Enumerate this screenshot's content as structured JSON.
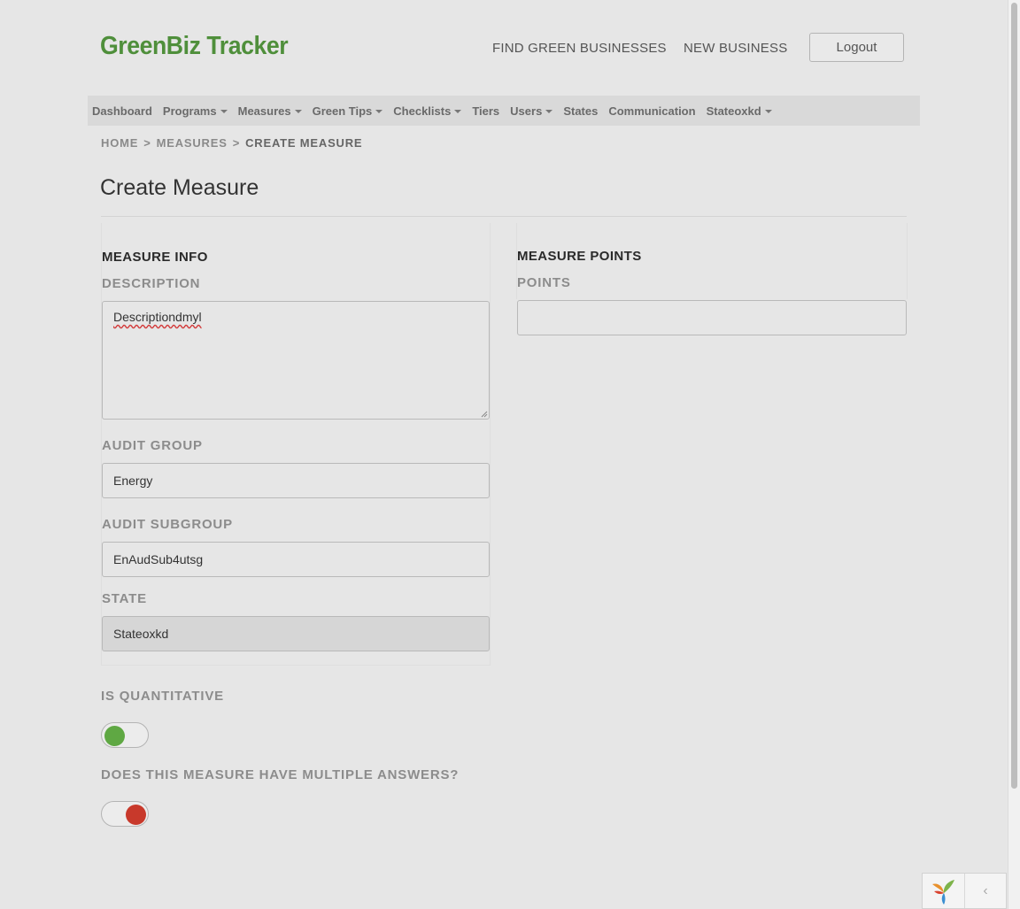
{
  "header": {
    "brand": "GreenBiz Tracker",
    "nav": [
      "FIND GREEN BUSINESSES",
      "NEW BUSINESS"
    ],
    "logout_label": "Logout"
  },
  "menu": {
    "items": [
      {
        "label": "Dashboard",
        "dropdown": false
      },
      {
        "label": "Programs",
        "dropdown": true
      },
      {
        "label": "Measures",
        "dropdown": true
      },
      {
        "label": "Green Tips",
        "dropdown": true
      },
      {
        "label": "Checklists",
        "dropdown": true
      },
      {
        "label": "Tiers",
        "dropdown": false
      },
      {
        "label": "Users",
        "dropdown": true
      },
      {
        "label": "States",
        "dropdown": false
      },
      {
        "label": "Communication",
        "dropdown": false
      },
      {
        "label": "Stateoxkd",
        "dropdown": true
      }
    ]
  },
  "breadcrumb": {
    "home": "HOME",
    "sep1": ">",
    "measures": "MEASURES",
    "sep2": ">",
    "current": "CREATE MEASURE"
  },
  "page": {
    "title": "Create Measure"
  },
  "measure_info": {
    "section_title": "MEASURE INFO",
    "description_label": "DESCRIPTION",
    "description_value": "Descriptiondmyl",
    "audit_group_label": "AUDIT GROUP",
    "audit_group_value": "Energy",
    "audit_subgroup_label": "AUDIT SUBGROUP",
    "audit_subgroup_value": "EnAudSub4utsg",
    "state_label": "STATE",
    "state_value": "Stateoxkd"
  },
  "measure_points": {
    "section_title": "MEASURE POINTS",
    "points_label": "POINTS",
    "points_value": ""
  },
  "toggles": {
    "is_quantitative_label": "IS QUANTITATIVE",
    "is_quantitative_on": true,
    "multiple_answers_label": "DOES THIS MEASURE HAVE MULTIPLE ANSWERS?",
    "multiple_answers_on": false
  },
  "colors": {
    "brand": "#4f8f3b",
    "toggle_on": "#5fa843",
    "toggle_off": "#c8392b",
    "background": "#e6e6e6"
  },
  "icons": {
    "caret": "caret-down-icon",
    "debug_logo": "yii-logo-icon",
    "debug_toggle": "chevron-left-icon"
  }
}
